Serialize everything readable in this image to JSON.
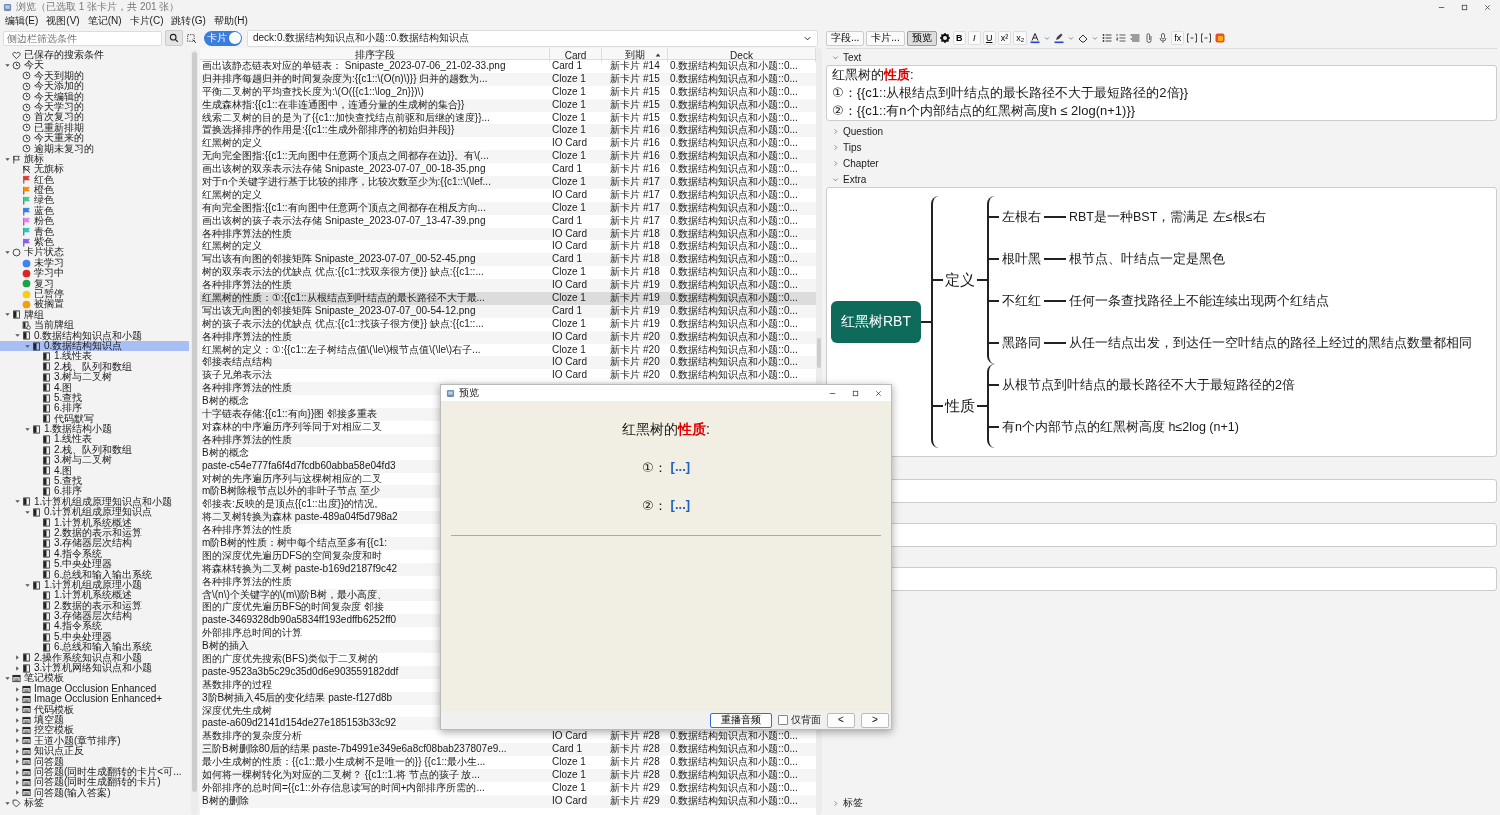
{
  "window": {
    "title": "浏览（已选取 1 张卡片，共 201 张）"
  },
  "menu": [
    "编辑(E)",
    "视图(V)",
    "笔记(N)",
    "卡片(C)",
    "跳转(G)",
    "帮助(H)"
  ],
  "sidebar": {
    "search": {
      "placeholder": "侧边栏筛选条件"
    },
    "tree": [
      {
        "label": "已保存的搜索条件",
        "kind": "heart",
        "selected": false
      },
      {
        "label": "今天",
        "kind": "clock",
        "expanded": true,
        "selected": false,
        "children": [
          {
            "label": "今天到期的",
            "kind": "clock",
            "selected": false
          },
          {
            "label": "今天添加的",
            "kind": "clock",
            "selected": false
          },
          {
            "label": "今天编辑的",
            "kind": "clock",
            "selected": false
          },
          {
            "label": "今天学习的",
            "kind": "clock",
            "selected": false
          },
          {
            "label": "首次复习的",
            "kind": "clock",
            "selected": false
          },
          {
            "label": "已重新排期",
            "kind": "clock",
            "selected": false
          },
          {
            "label": "今天重来的",
            "kind": "clock",
            "selected": false
          },
          {
            "label": "逾期未复习的",
            "kind": "clock",
            "selected": false
          }
        ]
      },
      {
        "label": "旗标",
        "kind": "flag",
        "expanded": true,
        "selected": false,
        "children": [
          {
            "label": "无旗标",
            "kind": "noflag",
            "selected": false
          },
          {
            "label": "红色",
            "kind": "flag",
            "color": "#e53935",
            "selected": false
          },
          {
            "label": "橙色",
            "kind": "flag",
            "color": "#fb8c00",
            "selected": false
          },
          {
            "label": "绿色",
            "kind": "flag",
            "color": "#43c98a",
            "selected": false
          },
          {
            "label": "蓝色",
            "kind": "flag",
            "color": "#2f80ed",
            "selected": false
          },
          {
            "label": "粉色",
            "kind": "flag",
            "color": "#e879f9",
            "selected": false
          },
          {
            "label": "青色",
            "kind": "flag",
            "color": "#22c7c0",
            "selected": false
          },
          {
            "label": "紫色",
            "kind": "flag",
            "color": "#8b5cf6",
            "selected": false
          }
        ]
      },
      {
        "label": "卡片状态",
        "kind": "ring",
        "expanded": true,
        "selected": false,
        "children": [
          {
            "label": "未学习",
            "kind": "dot",
            "color": "#3b82f6",
            "selected": false
          },
          {
            "label": "学习中",
            "kind": "dot",
            "color": "#dc2626",
            "selected": false
          },
          {
            "label": "复习",
            "kind": "dot",
            "color": "#16a34a",
            "selected": false
          },
          {
            "label": "已暂停",
            "kind": "dot",
            "color": "#facc15",
            "selected": false
          },
          {
            "label": "被搁置",
            "kind": "dot",
            "color": "#f59e0b",
            "selected": false
          }
        ]
      },
      {
        "label": "牌组",
        "kind": "deck",
        "expanded": true,
        "selected": false,
        "children": [
          {
            "label": "当前牌组",
            "kind": "current",
            "selected": false
          },
          {
            "label": "0.数据结构知识点和小题",
            "kind": "deck",
            "expanded": true,
            "selected": false,
            "children": [
              {
                "label": "0.数据结构知识点",
                "kind": "deck",
                "expanded": true,
                "selected": true,
                "children": [
                  {
                    "label": "1.线性表",
                    "kind": "deck",
                    "selected": false
                  },
                  {
                    "label": "2.栈、队列和数组",
                    "kind": "deck",
                    "selected": false
                  },
                  {
                    "label": "3.树与二叉树",
                    "kind": "deck",
                    "selected": false
                  },
                  {
                    "label": "4.图",
                    "kind": "deck",
                    "selected": false
                  },
                  {
                    "label": "5.查找",
                    "kind": "deck",
                    "selected": false
                  },
                  {
                    "label": "6.排序",
                    "kind": "deck",
                    "selected": false
                  },
                  {
                    "label": "代码默写",
                    "kind": "deck",
                    "selected": false
                  }
                ]
              },
              {
                "label": "1.数据结构小题",
                "kind": "deck",
                "expanded": true,
                "selected": false,
                "children": [
                  {
                    "label": "1.线性表",
                    "kind": "deck",
                    "selected": false
                  },
                  {
                    "label": "2.栈、队列和数组",
                    "kind": "deck",
                    "selected": false
                  },
                  {
                    "label": "3.树与二叉树",
                    "kind": "deck",
                    "selected": false
                  },
                  {
                    "label": "4.图",
                    "kind": "deck",
                    "selected": false
                  },
                  {
                    "label": "5.查找",
                    "kind": "deck",
                    "selected": false
                  },
                  {
                    "label": "6.排序",
                    "kind": "deck",
                    "selected": false
                  }
                ]
              }
            ]
          },
          {
            "label": "1.计算机组成原理知识点和小题",
            "kind": "deck",
            "expanded": true,
            "selected": false,
            "children": [
              {
                "label": "0.计算机组成原理知识点",
                "kind": "deck",
                "expanded": true,
                "selected": false,
                "children": [
                  {
                    "label": "1.计算机系统概述",
                    "kind": "deck",
                    "selected": false
                  },
                  {
                    "label": "2.数据的表示和运算",
                    "kind": "deck",
                    "selected": false
                  },
                  {
                    "label": "3.存储器层次结构",
                    "kind": "deck",
                    "selected": false
                  },
                  {
                    "label": "4.指令系统",
                    "kind": "deck",
                    "selected": false
                  },
                  {
                    "label": "5.中央处理器",
                    "kind": "deck",
                    "selected": false
                  },
                  {
                    "label": "6.总线和输入输出系统",
                    "kind": "deck",
                    "selected": false
                  }
                ]
              },
              {
                "label": "1.计算机组成原理小题",
                "kind": "deck",
                "expanded": true,
                "selected": false,
                "children": [
                  {
                    "label": "1.计算机系统概述",
                    "kind": "deck",
                    "selected": false
                  },
                  {
                    "label": "2.数据的表示和运算",
                    "kind": "deck",
                    "selected": false
                  },
                  {
                    "label": "3.存储器层次结构",
                    "kind": "deck",
                    "selected": false
                  },
                  {
                    "label": "4.指令系统",
                    "kind": "deck",
                    "selected": false
                  },
                  {
                    "label": "5.中央处理器",
                    "kind": "deck",
                    "selected": false
                  },
                  {
                    "label": "6.总线和输入输出系统",
                    "kind": "deck",
                    "selected": false
                  }
                ]
              }
            ]
          },
          {
            "label": "2.操作系统知识点和小题",
            "kind": "deck",
            "expanded": false,
            "selected": false
          },
          {
            "label": "3.计算机网络知识点和小题",
            "kind": "deck",
            "expanded": false,
            "selected": false
          }
        ]
      },
      {
        "label": "笔记模板",
        "kind": "notetype",
        "expanded": true,
        "selected": false,
        "children": [
          {
            "label": "Image Occlusion Enhanced",
            "kind": "notetype",
            "expanded": false,
            "selected": false
          },
          {
            "label": "Image Occlusion Enhanced+",
            "kind": "notetype",
            "expanded": false,
            "selected": false
          },
          {
            "label": "代码模板",
            "kind": "notetype",
            "expanded": false,
            "selected": false
          },
          {
            "label": "填空题",
            "kind": "notetype",
            "expanded": false,
            "selected": false
          },
          {
            "label": "挖空模板",
            "kind": "notetype",
            "expanded": false,
            "selected": false
          },
          {
            "label": "王道小题(章节排序)",
            "kind": "notetype",
            "expanded": false,
            "selected": false
          },
          {
            "label": "知识点正反",
            "kind": "notetype",
            "expanded": false,
            "selected": false
          },
          {
            "label": "问答题",
            "kind": "notetype",
            "expanded": false,
            "selected": false
          },
          {
            "label": "问答题(同时生成翻转的卡片<可...",
            "kind": "notetype",
            "expanded": false,
            "selected": false
          },
          {
            "label": "问答题(同时生成翻转的卡片)",
            "kind": "notetype",
            "expanded": false,
            "selected": false
          },
          {
            "label": "问答题(输入答案)",
            "kind": "notetype",
            "expanded": false,
            "selected": false
          }
        ]
      },
      {
        "label": "标签",
        "kind": "tag",
        "expanded": true,
        "selected": false
      }
    ]
  },
  "search_bar": {
    "toggle": {
      "label": "卡片",
      "on": true
    },
    "query": "deck:0.数据结构知识点和小题::0.数据结构知识点"
  },
  "table": {
    "columns": [
      {
        "label": "排序字段",
        "sorted": false
      },
      {
        "label": "Card",
        "sorted": false
      },
      {
        "label": "到期",
        "sorted": true
      },
      {
        "label": "Deck",
        "sorted": false
      }
    ],
    "rows": [
      {
        "sort": "画出该静态链表对应的单链表：  Snipaste_2023-07-06_21-02-33.png",
        "card": "Card 1",
        "due": "新卡片 #14",
        "deck": "0.数据结构知识点和小题::0...",
        "selected": false
      },
      {
        "sort": "归并排序每趟归并的时间复杂度为:{{c1::\\(O(n)\\)}} 归并的趟数为...",
        "card": "Cloze 1",
        "due": "新卡片 #15",
        "deck": "0.数据结构知识点和小题::0...",
        "selected": false
      },
      {
        "sort": "平衡二叉树的平均查找长度为:\\(O({{c1::\\log_2n}})\\)",
        "card": "Cloze 1",
        "due": "新卡片 #15",
        "deck": "0.数据结构知识点和小题::0...",
        "selected": false
      },
      {
        "sort": "生成森林指:{{c1::在非连通图中，连通分量的生成树的集合}}",
        "card": "Cloze 1",
        "due": "新卡片 #15",
        "deck": "0.数据结构知识点和小题::0...",
        "selected": false
      },
      {
        "sort": "线索二叉树的目的是为了{{c1::加快查找结点前驱和后继的速度}}...",
        "card": "Cloze 1",
        "due": "新卡片 #15",
        "deck": "0.数据结构知识点和小题::0...",
        "selected": false
      },
      {
        "sort": "置换选择排序的作用是:{{c1::生成外部排序的初始归并段}}",
        "card": "Cloze 1",
        "due": "新卡片 #16",
        "deck": "0.数据结构知识点和小题::0...",
        "selected": false
      },
      {
        "sort": "红黑树的定义",
        "card": "IO Card",
        "due": "新卡片 #16",
        "deck": "0.数据结构知识点和小题::0...",
        "selected": false
      },
      {
        "sort": "无向完全图指:{{c1::无向图中任意两个顶点之间都存在边}}。有\\(...",
        "card": "Cloze 1",
        "due": "新卡片 #16",
        "deck": "0.数据结构知识点和小题::0...",
        "selected": false
      },
      {
        "sort": "画出该树的双亲表示法存储  Snipaste_2023-07-07_00-18-35.png",
        "card": "Card 1",
        "due": "新卡片 #16",
        "deck": "0.数据结构知识点和小题::0...",
        "selected": false
      },
      {
        "sort": "对于n个关键字进行基于比较的排序，比较次数至少为:{{c1::\\(\\lef...",
        "card": "Cloze 1",
        "due": "新卡片 #17",
        "deck": "0.数据结构知识点和小题::0...",
        "selected": false
      },
      {
        "sort": "红黑树的定义",
        "card": "IO Card",
        "due": "新卡片 #17",
        "deck": "0.数据结构知识点和小题::0...",
        "selected": false
      },
      {
        "sort": "有向完全图指:{{c1::有向图中任意两个顶点之间都存在相反方向...",
        "card": "Cloze 1",
        "due": "新卡片 #17",
        "deck": "0.数据结构知识点和小题::0...",
        "selected": false
      },
      {
        "sort": "画出该树的孩子表示法存储  Snipaste_2023-07-07_13-47-39.png",
        "card": "Card 1",
        "due": "新卡片 #17",
        "deck": "0.数据结构知识点和小题::0...",
        "selected": false
      },
      {
        "sort": "各种排序算法的性质",
        "card": "IO Card",
        "due": "新卡片 #18",
        "deck": "0.数据结构知识点和小题::0...",
        "selected": false
      },
      {
        "sort": "红黑树的定义",
        "card": "IO Card",
        "due": "新卡片 #18",
        "deck": "0.数据结构知识点和小题::0...",
        "selected": false
      },
      {
        "sort": "写出该有向图的邻接矩阵  Snipaste_2023-07-07_00-52-45.png",
        "card": "Card 1",
        "due": "新卡片 #18",
        "deck": "0.数据结构知识点和小题::0...",
        "selected": false
      },
      {
        "sort": "树的双亲表示法的优缺点 优点:{{c1::找双亲很方便}} 缺点:{{c1::...",
        "card": "Cloze 1",
        "due": "新卡片 #18",
        "deck": "0.数据结构知识点和小题::0...",
        "selected": false
      },
      {
        "sort": "各种排序算法的性质",
        "card": "IO Card",
        "due": "新卡片 #19",
        "deck": "0.数据结构知识点和小题::0...",
        "selected": false
      },
      {
        "sort": "红黑树的性质：①:{{c1::从根结点到叶结点的最长路径不大于最...",
        "card": "Cloze 1",
        "due": "新卡片 #19",
        "deck": "0.数据结构知识点和小题::0...",
        "selected": true
      },
      {
        "sort": "写出该无向图的邻接矩阵  Snipaste_2023-07-07_00-54-12.png",
        "card": "Card 1",
        "due": "新卡片 #19",
        "deck": "0.数据结构知识点和小题::0...",
        "selected": false
      },
      {
        "sort": "树的孩子表示法的优缺点 优点:{{c1::找孩子很方便}} 缺点:{{c1::...",
        "card": "Cloze 1",
        "due": "新卡片 #19",
        "deck": "0.数据结构知识点和小题::0...",
        "selected": false
      },
      {
        "sort": "各种排序算法的性质",
        "card": "IO Card",
        "due": "新卡片 #20",
        "deck": "0.数据结构知识点和小题::0...",
        "selected": false
      },
      {
        "sort": "红黑树的定义：①:{{c1::左子树结点值\\(\\le\\)根节点值\\(\\le\\)右子...",
        "card": "Cloze 1",
        "due": "新卡片 #20",
        "deck": "0.数据结构知识点和小题::0...",
        "selected": false
      },
      {
        "sort": "邻接表结点结构",
        "card": "IO Card",
        "due": "新卡片 #20",
        "deck": "0.数据结构知识点和小题::0...",
        "selected": false
      },
      {
        "sort": "孩子兄弟表示法",
        "card": "IO Card",
        "due": "新卡片 #20",
        "deck": "0.数据结构知识点和小题::0...",
        "selected": false
      },
      {
        "sort": "各种排序算法的性质",
        "selected": false
      },
      {
        "sort": "B树的概念",
        "selected": false
      },
      {
        "sort": "十字链表存储:{{c1::有向}}图 邻接多重表",
        "selected": false
      },
      {
        "sort": "对森林的中序遍历序列等同于对相应二叉",
        "selected": false
      },
      {
        "sort": "各种排序算法的性质",
        "selected": false
      },
      {
        "sort": "B树的概念",
        "selected": false
      },
      {
        "sort": "paste-c54e777fa6f4d7fcdb60abba58e04fd3",
        "selected": false
      },
      {
        "sort": "对树的先序遍历序列与这棵树相应的二叉",
        "selected": false
      },
      {
        "sort": "m阶B树除根节点以外的非叶子节点 至少",
        "selected": false
      },
      {
        "sort": "邻接表:反映的是顶点{{c1::出度}}的情况。",
        "selected": false
      },
      {
        "sort": "将二叉树转换为森林  paste-489a04f5d798a2",
        "selected": false
      },
      {
        "sort": "各种排序算法的性质",
        "selected": false
      },
      {
        "sort": "m阶B树的性质：树中每个结点至多有{{c1:",
        "selected": false
      },
      {
        "sort": "图的深度优先遍历DFS的空间复杂度和时",
        "selected": false
      },
      {
        "sort": "将森林转换为二叉树  paste-b169d2187f9c42",
        "selected": false
      },
      {
        "sort": "各种排序算法的性质",
        "selected": false
      },
      {
        "sort": "含\\(n\\)个关键字的\\(m\\)阶B树，最小高度、",
        "selected": false
      },
      {
        "sort": "图的广度优先遍历BFS的时间复杂度 邻接",
        "selected": false
      },
      {
        "sort": "paste-3469328db90a5834ff193edffb6252ff0",
        "selected": false
      },
      {
        "sort": "外部排序总时间的计算",
        "selected": false
      },
      {
        "sort": "B树的插入",
        "selected": false
      },
      {
        "sort": "图的广度优先搜索(BFS)类似于二叉树的",
        "selected": false
      },
      {
        "sort": "paste-9523a3b5c29c35d0d6e903559182ddf",
        "selected": false
      },
      {
        "sort": "基数排序的过程",
        "selected": false
      },
      {
        "sort": "3阶B树插入45后的变化结果  paste-f127d8b",
        "selected": false
      },
      {
        "sort": "深度优先生成树",
        "selected": false
      },
      {
        "sort": "paste-a609d2141d154de27e185153b33c92",
        "selected": false
      },
      {
        "sort": "基数排序的复杂度分析",
        "card": "IO Card",
        "due": "新卡片 #28",
        "deck": "0.数据结构知识点和小题::0...",
        "selected": false
      },
      {
        "sort": "三阶B树删除80后的结果  paste-7b4991e349e6a8cf08bab237807e9...",
        "card": "Card 1",
        "due": "新卡片 #28",
        "deck": "0.数据结构知识点和小题::0...",
        "selected": false
      },
      {
        "sort": "最小生成树的性质：{{c1::最小生成树不是唯一的}} {{c1::最小生...",
        "card": "Cloze 1",
        "due": "新卡片 #28",
        "deck": "0.数据结构知识点和小题::0...",
        "selected": false
      },
      {
        "sort": "如何将一棵树转化为对应的二叉树？ {{c1::1.将 节点的孩子 放...",
        "card": "Cloze 1",
        "due": "新卡片 #28",
        "deck": "0.数据结构知识点和小题::0...",
        "selected": false
      },
      {
        "sort": "外部排序的总时间={{c1::外存信息读写的时间+内部排序所需的...",
        "card": "Cloze 1",
        "due": "新卡片 #29",
        "deck": "0.数据结构知识点和小题::0...",
        "selected": false
      },
      {
        "sort": "B树的删除",
        "card": "IO Card",
        "due": "新卡片 #29",
        "deck": "0.数据结构知识点和小题::0...",
        "selected": false
      }
    ]
  },
  "editor": {
    "toolbar": [
      {
        "kind": "button",
        "label": "字段...",
        "selected": false
      },
      {
        "kind": "button",
        "label": "卡片...",
        "selected": false
      },
      {
        "kind": "button",
        "label": "预览",
        "selected": true
      },
      {
        "kind": "gear"
      },
      {
        "kind": "char",
        "label": "B"
      },
      {
        "kind": "char",
        "label": "I"
      },
      {
        "kind": "char",
        "label": "U"
      },
      {
        "kind": "char",
        "label": "x²"
      },
      {
        "kind": "char",
        "label": "x₂"
      },
      {
        "kind": "textcolor"
      },
      {
        "kind": "caret"
      },
      {
        "kind": "highlighter"
      },
      {
        "kind": "caret"
      },
      {
        "kind": "eraser"
      },
      {
        "kind": "caret"
      },
      {
        "kind": "bullets"
      },
      {
        "kind": "numbers"
      },
      {
        "kind": "align"
      },
      {
        "kind": "clip"
      },
      {
        "kind": "mic"
      },
      {
        "kind": "char",
        "label": "fx"
      },
      {
        "kind": "cloze"
      },
      {
        "kind": "cloze"
      },
      {
        "kind": "palette"
      }
    ],
    "fields": [
      {
        "label": "Text",
        "expanded": true,
        "lines": [
          "红黑树的**性质**:",
          "①：{{c1::从根结点到叶结点的最长路径不大于最短路径的2倍}}",
          "②：{{c1::有n个内部结点的红黑树高度h ≤ 2log(n+1)}}"
        ]
      },
      {
        "label": "Question",
        "expanded": false
      },
      {
        "label": "Tips",
        "expanded": false
      },
      {
        "label": "Chapter",
        "expanded": false
      },
      {
        "label": "Extra",
        "expanded": true,
        "mind_map": {
          "root": "红黑树RBT",
          "branches": [
            {
              "label": "定义",
              "items": [
                {
                  "key": "左根右",
                  "value": "RBT是一种BST，需满足 左≤根≤右"
                },
                {
                  "key": "根叶黑",
                  "value": "根节点、叶结点一定是黑色"
                },
                {
                  "key": "不红红",
                  "value": "任何一条查找路径上不能连续出现两个红结点"
                },
                {
                  "key": "黑路同",
                  "value": "从任一结点出发，到达任一空叶结点的路径上经过的黑结点数量都相同"
                }
              ]
            },
            {
              "label": "性质",
              "items": [
                {
                  "value": "从根节点到叶结点的最长路径不大于最短路径的2倍"
                },
                {
                  "value": "有n个内部节点的红黑树高度 h≤2log (n+1)"
                }
              ]
            }
          ]
        }
      },
      {
        "expanded": true
      },
      {
        "expanded": true
      },
      {
        "expanded": true
      }
    ],
    "tags": {
      "label": "标签",
      "expanded": false
    }
  },
  "preview": {
    "title": "预览",
    "heading": "红黑树的**性质**:",
    "lines": [
      {
        "label": "①：",
        "cloze": "[...]"
      },
      {
        "label": "②：",
        "cloze": "[...]"
      }
    ],
    "replay": "重播音频",
    "back_only": {
      "label": "仅背面",
      "checked": false
    },
    "prev": "<",
    "next": ">"
  }
}
